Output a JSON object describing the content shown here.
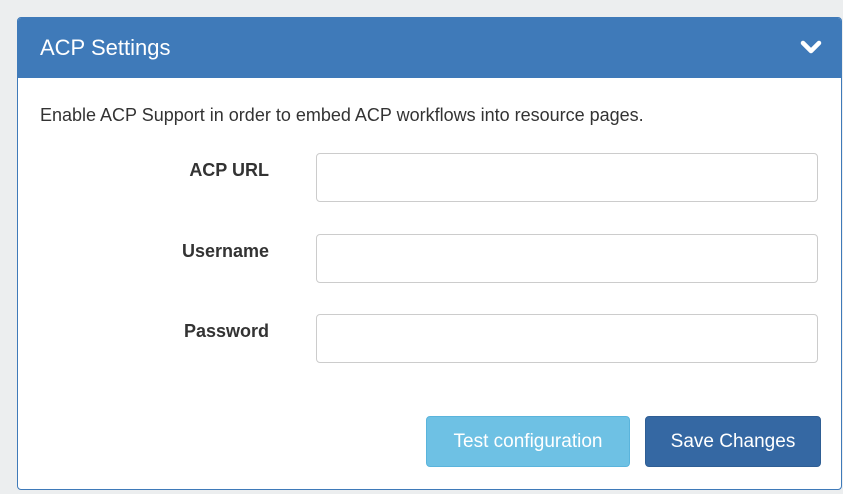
{
  "panel": {
    "title": "ACP Settings",
    "toggle_icon": "chevron-down-icon"
  },
  "description": "Enable ACP Support in order to embed ACP workflows into resource pages.",
  "form": {
    "acp_url": {
      "label": "ACP URL",
      "value": "",
      "placeholder": ""
    },
    "username": {
      "label": "Username",
      "value": "",
      "placeholder": ""
    },
    "password": {
      "label": "Password",
      "value": "",
      "placeholder": ""
    }
  },
  "buttons": {
    "test_label": "Test configuration",
    "save_label": "Save Changes"
  },
  "colors": {
    "header": "#3f7ab9",
    "test_button": "#6ec1e4",
    "save_button": "#3568a3"
  }
}
